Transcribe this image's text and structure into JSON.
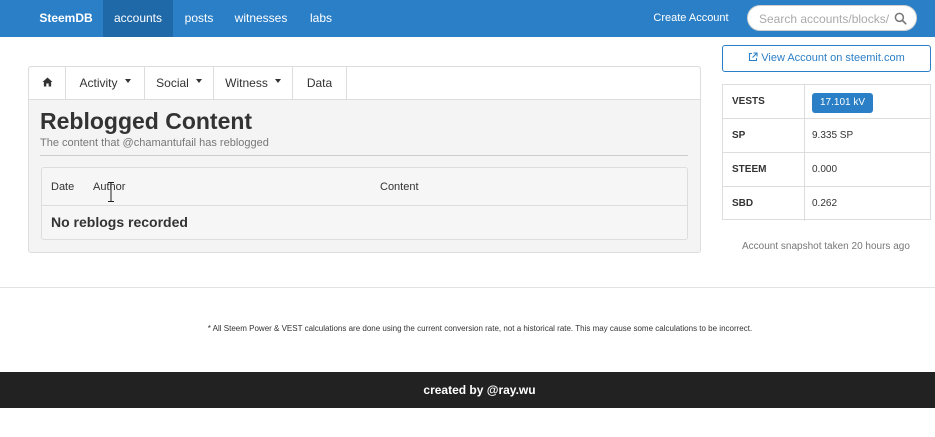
{
  "navbar": {
    "brand": "SteemDB",
    "items": [
      "accounts",
      "posts",
      "witnesses",
      "labs"
    ],
    "active": "accounts",
    "create_account": "Create Account",
    "search_placeholder": "Search accounts/blocks/tr",
    "colors": {
      "bar": "#2b7fc6",
      "active": "#1f69a8"
    }
  },
  "tabs": {
    "home_icon": "home-icon",
    "items": [
      "Activity",
      "Social",
      "Witness",
      "Data"
    ]
  },
  "page": {
    "title": "Reblogged Content",
    "subtitle": "The content that @chamantufail has reblogged"
  },
  "table": {
    "columns": [
      "Date",
      "Author",
      "Content"
    ],
    "empty_message": "No reblogs recorded"
  },
  "sidebar": {
    "view_button": "View Account on steemit.com",
    "stats": [
      {
        "label": "VESTS",
        "value": "17.101 kV",
        "badge": true
      },
      {
        "label": "SP",
        "value": "9.335 SP"
      },
      {
        "label": "STEEM",
        "value": "0.000"
      },
      {
        "label": "SBD",
        "value": "0.262"
      }
    ],
    "snapshot": "Account snapshot taken 20 hours ago"
  },
  "footer": {
    "disclaimer": "* All Steem Power & VEST calculations are done using the current conversion rate, not a historical rate. This may cause some calculations to be incorrect.",
    "credit": "created by @ray.wu"
  }
}
